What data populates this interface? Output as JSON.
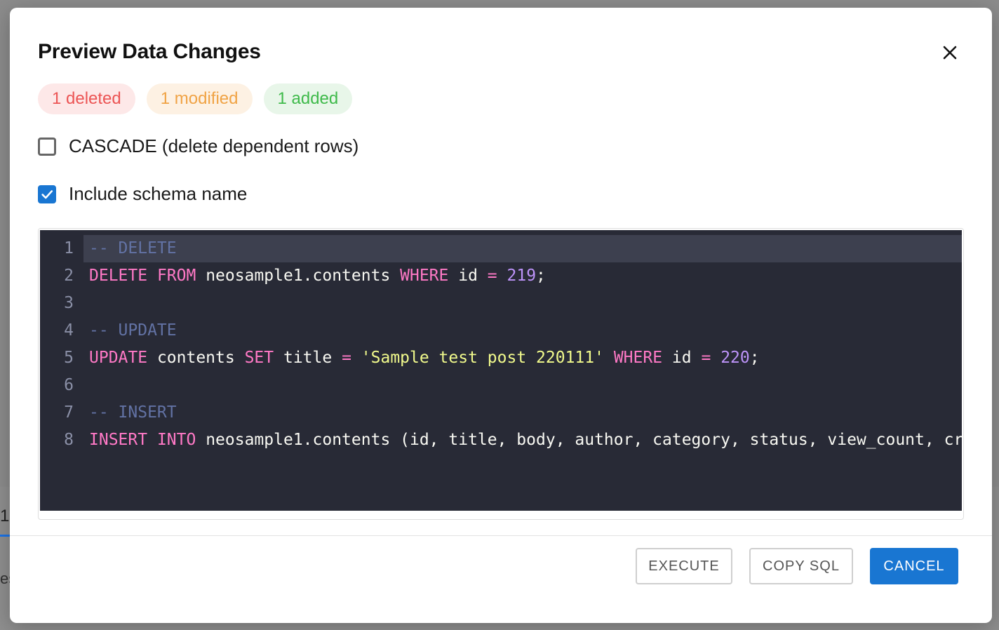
{
  "dialog": {
    "title": "Preview Data Changes",
    "close_icon": "close-icon"
  },
  "badges": {
    "deleted": "1 deleted",
    "modified": "1 modified",
    "added": "1 added"
  },
  "options": {
    "cascade": {
      "label": "CASCADE (delete dependent rows)",
      "checked": false
    },
    "schema": {
      "label": "Include schema name",
      "checked": true
    }
  },
  "editor": {
    "lines": [
      {
        "number": "1",
        "tokens": [
          {
            "t": "-- DELETE",
            "c": "cm"
          }
        ]
      },
      {
        "number": "2",
        "tokens": [
          {
            "t": "DELETE",
            "c": "kw"
          },
          {
            "t": " ",
            "c": "id"
          },
          {
            "t": "FROM",
            "c": "kw"
          },
          {
            "t": " neosample1.contents ",
            "c": "id"
          },
          {
            "t": "WHERE",
            "c": "kw"
          },
          {
            "t": " id ",
            "c": "id"
          },
          {
            "t": "=",
            "c": "op"
          },
          {
            "t": " ",
            "c": "id"
          },
          {
            "t": "219",
            "c": "num"
          },
          {
            "t": ";",
            "c": "id"
          }
        ]
      },
      {
        "number": "3",
        "tokens": []
      },
      {
        "number": "4",
        "tokens": [
          {
            "t": "-- UPDATE",
            "c": "cm"
          }
        ]
      },
      {
        "number": "5",
        "tokens": [
          {
            "t": "UPDATE",
            "c": "kw"
          },
          {
            "t": " contents ",
            "c": "id"
          },
          {
            "t": "SET",
            "c": "kw"
          },
          {
            "t": " title ",
            "c": "id"
          },
          {
            "t": "=",
            "c": "op"
          },
          {
            "t": " ",
            "c": "id"
          },
          {
            "t": "'Sample test post 220111'",
            "c": "str"
          },
          {
            "t": " ",
            "c": "id"
          },
          {
            "t": "WHERE",
            "c": "kw"
          },
          {
            "t": " id ",
            "c": "id"
          },
          {
            "t": "=",
            "c": "op"
          },
          {
            "t": " ",
            "c": "id"
          },
          {
            "t": "220",
            "c": "num"
          },
          {
            "t": ";",
            "c": "id"
          }
        ]
      },
      {
        "number": "6",
        "tokens": []
      },
      {
        "number": "7",
        "tokens": [
          {
            "t": "-- INSERT",
            "c": "cm"
          }
        ]
      },
      {
        "number": "8",
        "tokens": [
          {
            "t": "INSERT",
            "c": "kw"
          },
          {
            "t": " ",
            "c": "id"
          },
          {
            "t": "INTO",
            "c": "kw"
          },
          {
            "t": " neosample1.contents (id, title, body, author, category, status, view_count, cr",
            "c": "id"
          }
        ]
      }
    ]
  },
  "actions": {
    "execute": "EXECUTE",
    "copy_sql": "COPY SQL",
    "cancel": "CANCEL"
  },
  "background": {
    "tab_fragment": "1",
    "text_fragment": "es"
  }
}
